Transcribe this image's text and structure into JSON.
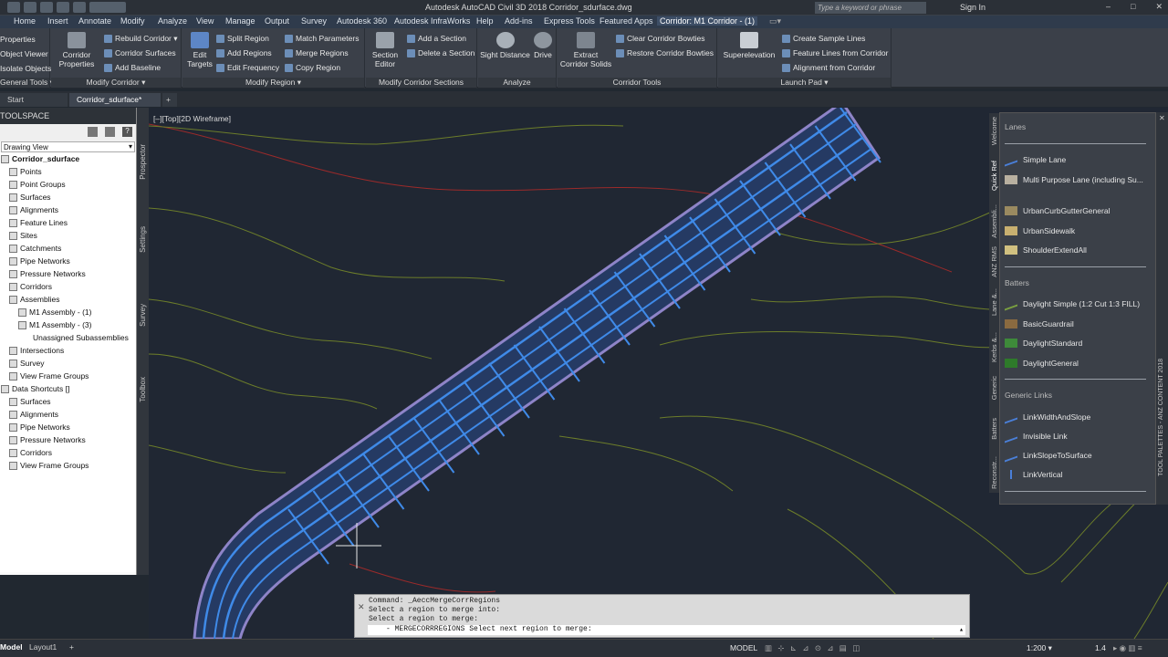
{
  "titlebar": {
    "title": "Autodesk AutoCAD Civil 3D 2018    Corridor_sdurface.dwg",
    "search_placeholder": "Type a keyword or phrase",
    "sign_in": "Sign In",
    "window_buttons": [
      "–",
      "□",
      "✕"
    ]
  },
  "menubar": {
    "items": [
      "Home",
      "Insert",
      "Annotate",
      "Modify",
      "Analyze",
      "View",
      "Manage",
      "Output",
      "Survey",
      "Autodesk 360",
      "Autodesk InfraWorks",
      "Help",
      "Add-ins",
      "Express Tools",
      "Featured Apps",
      "Corridor: M1 Corridor - (1)"
    ]
  },
  "ribbon": {
    "general": {
      "items": [
        "Properties",
        "Object Viewer",
        "Isolate Objects"
      ],
      "title": "General Tools ▾"
    },
    "modify_corridor": {
      "big": "Corridor Properties",
      "items": [
        "Rebuild Corridor ▾",
        "Corridor Surfaces",
        "Add Baseline"
      ],
      "title": "Modify Corridor ▾"
    },
    "modify_region": {
      "big": "Edit Targets",
      "items": [
        "Split Region",
        "Add Regions",
        "Edit Frequency",
        "Match Parameters",
        "Merge Regions",
        "Copy Region"
      ],
      "title": "Modify Region ▾"
    },
    "sections": {
      "big": "Section Editor",
      "items": [
        "Add a Section",
        "Delete a Section"
      ],
      "title": "Modify Corridor Sections"
    },
    "analyze": {
      "items": [
        "Sight Distance",
        "Drive"
      ],
      "title": "Analyze"
    },
    "corridor_tools": {
      "big": "Extract Corridor Solids",
      "items": [
        "Clear Corridor Bowties",
        "Restore Corridor Bowties"
      ],
      "title": "Corridor Tools"
    },
    "launch_pad": {
      "big": "Superelevation",
      "items": [
        "Create Sample Lines",
        "Feature Lines from Corridor",
        "Alignment from Corridor"
      ],
      "title": "Launch Pad ▾"
    }
  },
  "tabs": [
    "Start",
    "Corridor_sdurface*",
    "+"
  ],
  "toolspace": {
    "title": "TOOLSPACE",
    "view": "Drawing View",
    "tree": [
      {
        "label": "Corridor_sdurface",
        "bold": true
      },
      {
        "label": "Points"
      },
      {
        "label": "Point Groups"
      },
      {
        "label": "Surfaces"
      },
      {
        "label": "Alignments"
      },
      {
        "label": "Feature Lines"
      },
      {
        "label": "Sites"
      },
      {
        "label": "Catchments"
      },
      {
        "label": "Pipe Networks"
      },
      {
        "label": "Pressure Networks"
      },
      {
        "label": "Corridors"
      },
      {
        "label": "Assemblies"
      },
      {
        "label": "M1 Assembly - (1)"
      },
      {
        "label": "M1 Assembly - (3)"
      },
      {
        "label": "Unassigned Subassemblies"
      },
      {
        "label": "Intersections"
      },
      {
        "label": "Survey"
      },
      {
        "label": "View Frame Groups"
      },
      {
        "label": "Data Shortcuts []"
      },
      {
        "label": "Surfaces"
      },
      {
        "label": "Alignments"
      },
      {
        "label": "Pipe Networks"
      },
      {
        "label": "Pressure Networks"
      },
      {
        "label": "Corridors"
      },
      {
        "label": "View Frame Groups"
      }
    ],
    "side_tabs": [
      "Prospector",
      "Settings",
      "Survey",
      "Toolbox"
    ]
  },
  "viewport": {
    "label": "[–][Top][2D Wireframe]"
  },
  "palette": {
    "tabs": [
      "Welcome",
      "Quick Ref",
      "Assembli...",
      "ANZ RMS",
      "Lane &...",
      "Kerbs &...",
      "Generic",
      "Batters",
      "Reconstr..."
    ],
    "side_label": "TOOL PALETTES - ANZ CONTENT 2018",
    "groups": [
      {
        "title": "Lanes",
        "items": [
          "Simple Lane",
          "Multi Purpose Lane (including Su...",
          "UrbanCurbGutterGeneral",
          "UrbanSidewalk",
          "ShoulderExtendAll"
        ]
      },
      {
        "title": "Batters",
        "items": [
          "Daylight Simple (1:2 Cut 1:3 FILL)",
          "BasicGuardrail",
          "DaylightStandard",
          "DaylightGeneral"
        ]
      },
      {
        "title": "Generic Links",
        "items": [
          "LinkWidthAndSlope",
          "Invisible Link",
          "LinkSlopeToSurface",
          "LinkVertical"
        ]
      }
    ]
  },
  "command": {
    "history": [
      "Command: _AeccMergeCorrRegions",
      "Select a region to merge into:",
      "Select a region to merge:"
    ],
    "prompt": "- MERGECORRREGIONS Select next region to merge:"
  },
  "statusbar": {
    "tabs": [
      "Model",
      "Layout1",
      "+"
    ],
    "model": "MODEL",
    "scale": "1:200 ▾",
    "lineweight": "1.4"
  }
}
